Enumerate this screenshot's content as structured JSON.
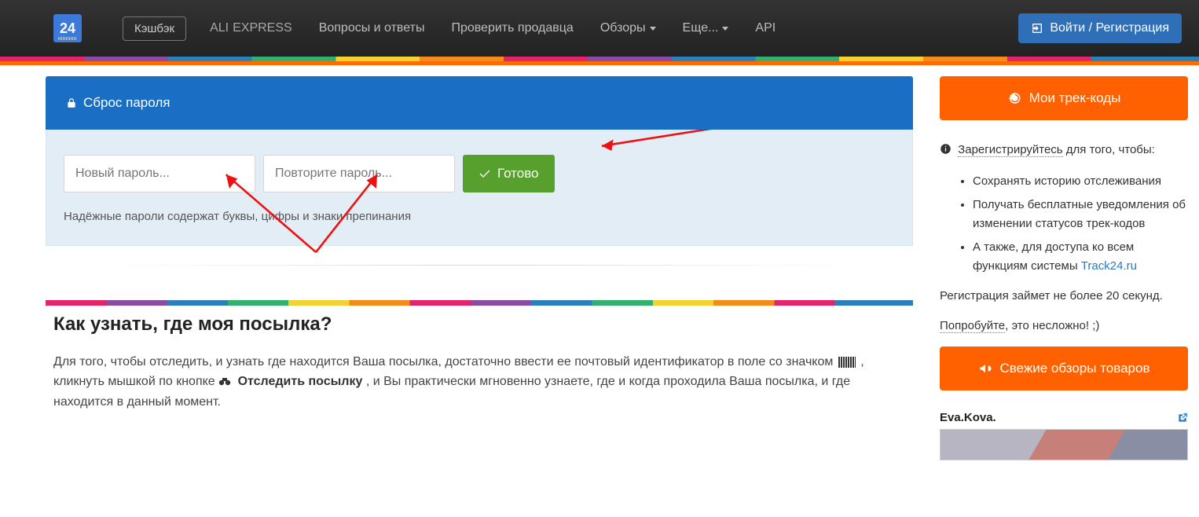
{
  "nav": {
    "logo_text": "24",
    "cashback": "Кэшбэк",
    "aliexpress_a": "ALI",
    "aliexpress_b": "EXPRESS",
    "qa": "Вопросы и ответы",
    "check_seller": "Проверить продавца",
    "reviews": "Обзоры",
    "more": "Еще...",
    "api": "API",
    "login": "Войти / Регистрация"
  },
  "reset": {
    "title": "Сброс пароля",
    "placeholder_new": "Новый пароль...",
    "placeholder_repeat": "Повторите пароль...",
    "submit": "Готово",
    "hint": "Надёжные пароли содержат буквы, цифры и знаки препинания"
  },
  "article": {
    "heading": "Как узнать, где моя посылка?",
    "p1_a": "Для того, чтобы отследить, и узнать где находится Ваша посылка, достаточно ввести ее почтовый идентификатор в поле со значком ",
    "p1_b": ", кликнуть мышкой по кнопке ",
    "track_btn": "Отследить посылку",
    "p1_c": ", и Вы практически мгновенно узнаете, где и когда проходила Ваша посылка, и где находится в данный момент."
  },
  "side": {
    "mytracks": "Мои трек-коды",
    "register_lead": "Зарегистрируйтесь",
    "register_tail": " для того, чтобы:",
    "b1": "Сохранять историю отслеживания",
    "b2": "Получать бесплатные уведомления об изменении статусов трек-кодов",
    "b3": "А также, для доступа ко всем функциям системы ",
    "site_link": "Track24.ru",
    "reg_time": "Регистрация займет не более 20 секунд.",
    "try_a": "Попробуйте",
    "try_b": ", это несложно! ;)",
    "freshreviews": "Свежие обзоры товаров",
    "review_author": "Eva.Kova."
  }
}
